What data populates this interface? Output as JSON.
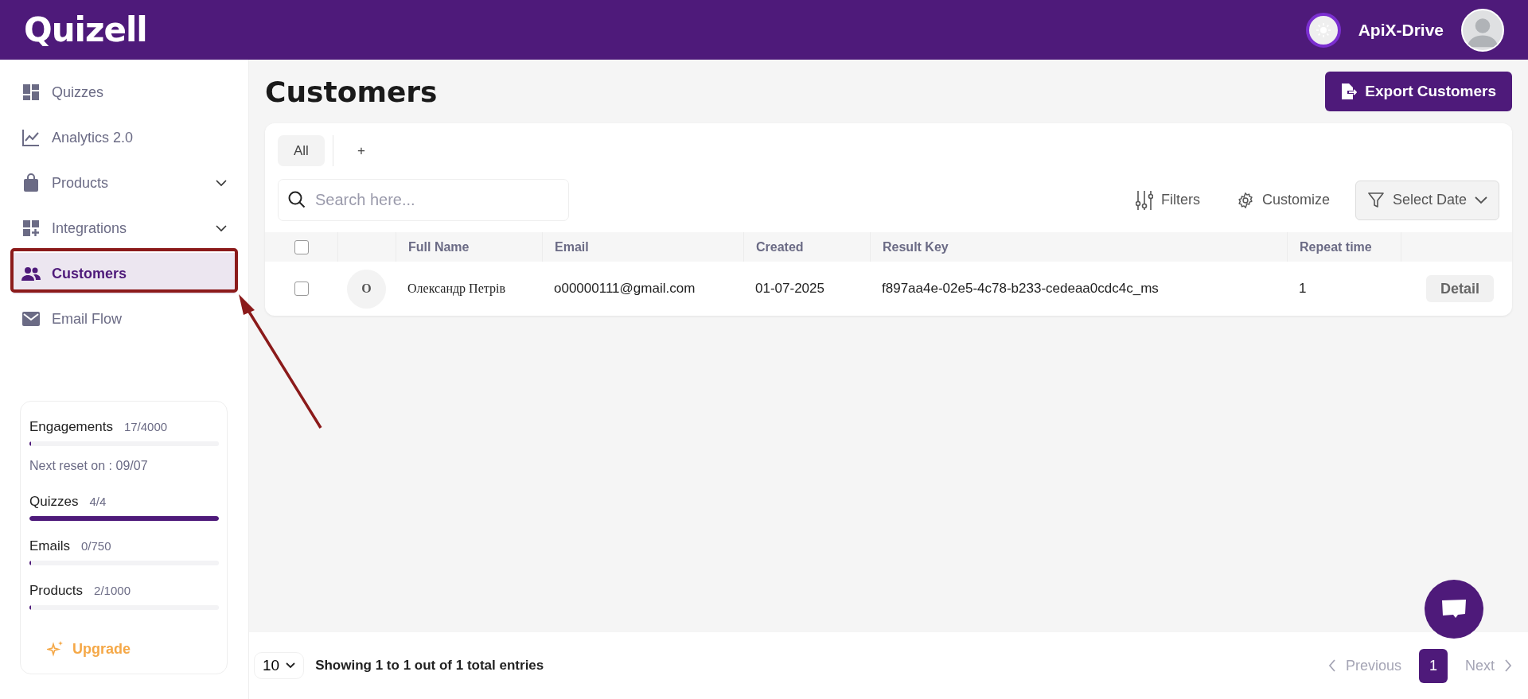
{
  "header": {
    "logo": "Quizell",
    "user_name": "ApiX-Drive"
  },
  "sidebar": {
    "items": [
      {
        "label": "Quizzes",
        "selected": false,
        "has_submenu": false
      },
      {
        "label": "Analytics 2.0",
        "selected": false,
        "has_submenu": false
      },
      {
        "label": "Products",
        "selected": false,
        "has_submenu": true
      },
      {
        "label": "Integrations",
        "selected": false,
        "has_submenu": true
      },
      {
        "label": "Customers",
        "selected": true,
        "has_submenu": false
      },
      {
        "label": "Email Flow",
        "selected": false,
        "has_submenu": false
      }
    ]
  },
  "usage": {
    "items": [
      {
        "kind": "meter",
        "label": "Engagements",
        "count": "17/4000",
        "level": 0.004
      },
      {
        "kind": "note",
        "text": "Next reset on : 09/07"
      },
      {
        "kind": "meter",
        "label": "Quizzes",
        "count": "4/4",
        "level": 1
      },
      {
        "kind": "meter",
        "label": "Emails",
        "count": "0/750",
        "level": 0
      },
      {
        "kind": "meter",
        "label": "Products",
        "count": "2/1000",
        "level": 0.002
      }
    ],
    "upgrade": "Upgrade"
  },
  "page": {
    "title": "Customers",
    "export_button": "Export Customers"
  },
  "tabs": [
    {
      "label": "All",
      "selected": true
    },
    {
      "label": "+",
      "selected": false
    }
  ],
  "search": {
    "placeholder": "Search here..."
  },
  "toolbar": {
    "filters": "Filters",
    "customize": "Customize",
    "date": "Select Date"
  },
  "table": {
    "header_checked": false,
    "columns": [
      "Full Name",
      "Email",
      "Created",
      "Result Key",
      "Repeat time"
    ],
    "rows": [
      {
        "checked": false,
        "initial": "O",
        "full_name": "Олександр Петрів",
        "email": "o00000111@gmail.com",
        "created": "01-07-2025",
        "result_key": "f897aa4e-02e5-4c78-b233-cedeaa0cdc4c_ms",
        "repeat_time": "1",
        "action": "Detail"
      }
    ]
  },
  "footer": {
    "page_size": "10",
    "summary": "Showing 1 to 1 out of 1 total entries",
    "previous": "Previous",
    "pages": [
      {
        "label": "1",
        "selected": true
      }
    ],
    "next": "Next"
  }
}
